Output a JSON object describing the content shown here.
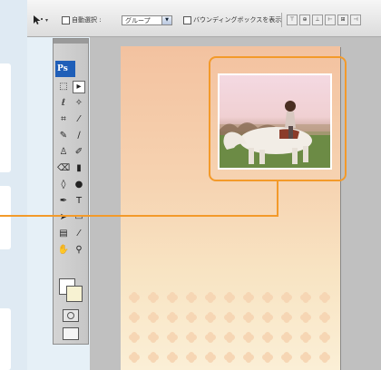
{
  "options_bar": {
    "auto_select_label": "自動選択 :",
    "auto_select_value": "グループ",
    "bounding_box_label": "バウンディングボックスを表示",
    "tool_preset_icon": "move-tool-icon",
    "align_buttons": [
      "top-align-icon",
      "vcenter-align-icon",
      "bottom-align-icon",
      "left-align-icon",
      "hcenter-align-icon"
    ]
  },
  "toolbox": {
    "logo": "Ps",
    "tools": [
      {
        "name": "marquee-tool-icon",
        "glyph": "⬚"
      },
      {
        "name": "move-tool-icon",
        "glyph": "▸",
        "active": true
      },
      {
        "name": "lasso-tool-icon",
        "glyph": "ℓ"
      },
      {
        "name": "magic-wand-tool-icon",
        "glyph": "✧"
      },
      {
        "name": "crop-tool-icon",
        "glyph": "⌗"
      },
      {
        "name": "eyedropper-tool-icon",
        "glyph": "⁄"
      },
      {
        "name": "healing-brush-tool-icon",
        "glyph": "✎"
      },
      {
        "name": "brush-tool-icon",
        "glyph": "∕"
      },
      {
        "name": "clone-stamp-tool-icon",
        "glyph": "♙"
      },
      {
        "name": "history-brush-tool-icon",
        "glyph": "✐"
      },
      {
        "name": "eraser-tool-icon",
        "glyph": "⌫"
      },
      {
        "name": "gradient-tool-icon",
        "glyph": "▮"
      },
      {
        "name": "blur-tool-icon",
        "glyph": "◊"
      },
      {
        "name": "dodge-tool-icon",
        "glyph": "●"
      },
      {
        "name": "pen-tool-icon",
        "glyph": "✒"
      },
      {
        "name": "type-tool-icon",
        "glyph": "T"
      },
      {
        "name": "path-selection-tool-icon",
        "glyph": "➤"
      },
      {
        "name": "shape-tool-icon",
        "glyph": "▭"
      },
      {
        "name": "notes-tool-icon",
        "glyph": "▤"
      },
      {
        "name": "eyedropper2-tool-icon",
        "glyph": "⁄"
      },
      {
        "name": "hand-tool-icon",
        "glyph": "✋"
      },
      {
        "name": "zoom-tool-icon",
        "glyph": "⚲"
      }
    ],
    "foreground_color": "#ffffff",
    "background_color": "#f7f2d2"
  },
  "colors": {
    "highlight": "#f39a2a",
    "canvas_bg": "#c0c0c0"
  }
}
